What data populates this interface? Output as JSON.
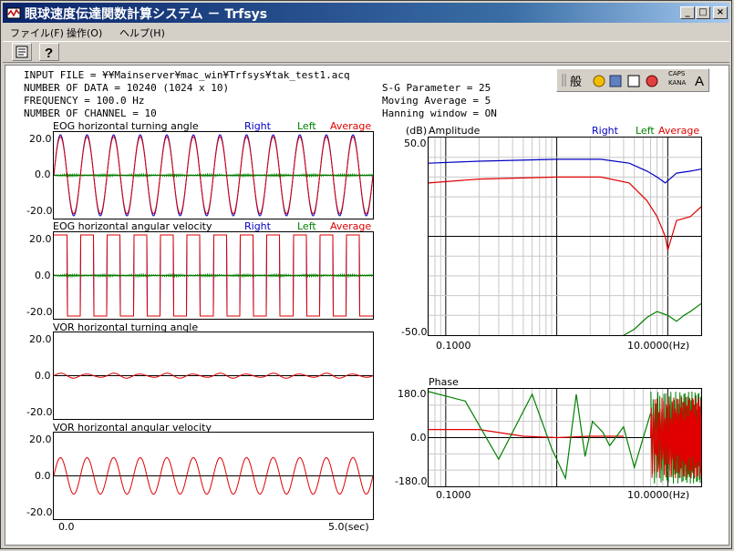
{
  "window": {
    "title": "眼球速度伝達関数計算システム － Trfsys",
    "min_glyph": "_",
    "max_glyph": "□",
    "close_glyph": "×"
  },
  "menu": {
    "file": "ファイル(F)",
    "operate": "操作(O)",
    "help": "ヘルプ(H)"
  },
  "info": {
    "input_file": "INPUT FILE = ¥¥Mainserver¥mac_win¥Trfsys¥tak_test1.acq",
    "num_data": "NUMBER OF DATA = 10240 (1024 x 10)",
    "frequency": "FREQUENCY = 100.0 Hz",
    "num_channel": "NUMBER OF CHANNEL = 10",
    "sg": "S-G Parameter = 25",
    "moving_avg": "Moving Average = 5",
    "hanning": "Hanning window = ON"
  },
  "ime_bar": {
    "mode": "般",
    "caps": "CAPS",
    "kana": "KANA"
  },
  "legend": {
    "right": "Right",
    "left": "Left",
    "average": "Average"
  },
  "colors": {
    "right": "#0000c0",
    "left": "#008000",
    "average": "#e00000",
    "grid": "#c8c8c8"
  },
  "charts": [
    {
      "title": "EOG horizontal turning angle",
      "legend": true,
      "ticks": [
        "20.0",
        "0.0",
        "-20.0"
      ]
    },
    {
      "title": "EOG horizontal angular velocity",
      "legend": true,
      "ticks": [
        "20.0",
        "0.0",
        "-20.0"
      ]
    },
    {
      "title": "VOR horizontal turning angle",
      "legend": false,
      "ticks": [
        "20.0",
        "0.0",
        "-20.0"
      ]
    },
    {
      "title": "VOR horizontal angular velocity",
      "legend": false,
      "ticks": [
        "20.0",
        "0.0",
        "-20.0"
      ]
    }
  ],
  "time_axis": {
    "start": "0.0",
    "end": "5.0(sec)"
  },
  "amplitude": {
    "unit": "(dB)",
    "title": "Amplitude",
    "ytop": "50.0",
    "ybottom": "-50.0",
    "xleft": "0.1000",
    "xright": "10.0000(Hz)"
  },
  "phase": {
    "title": "Phase",
    "ytop": "180.0",
    "ymid": "0.0",
    "ybottom": "-180.0",
    "xleft": "0.1000",
    "xright": "10.0000(Hz)"
  },
  "chart_data": [
    {
      "type": "line",
      "title": "EOG horizontal turning angle",
      "ylim": [
        -20,
        20
      ],
      "xlim": [
        0,
        5
      ],
      "series": [
        {
          "name": "Right",
          "cycles": 12,
          "amplitude": 20
        },
        {
          "name": "Left",
          "cycles": 12,
          "amplitude": 0.5
        },
        {
          "name": "Average",
          "cycles": 12,
          "amplitude": 19
        }
      ]
    },
    {
      "type": "line",
      "title": "EOG horizontal angular velocity",
      "ylim": [
        -20,
        20
      ],
      "xlim": [
        0,
        5
      ],
      "series": [
        {
          "name": "Right",
          "shape": "square",
          "cycles": 12,
          "amplitude": 20
        },
        {
          "name": "Left",
          "amplitude": 0.5
        },
        {
          "name": "Average",
          "shape": "square",
          "cycles": 12,
          "amplitude": 20
        }
      ]
    },
    {
      "type": "line",
      "title": "VOR horizontal turning angle",
      "ylim": [
        -20,
        20
      ],
      "xlim": [
        0,
        5
      ],
      "series": [
        {
          "name": "Average",
          "cycles": 12,
          "amplitude": 1
        }
      ]
    },
    {
      "type": "line",
      "title": "VOR horizontal angular velocity",
      "ylim": [
        -20,
        20
      ],
      "xlim": [
        0,
        5
      ],
      "series": [
        {
          "name": "Average",
          "cycles": 12,
          "amplitude": 9
        }
      ]
    },
    {
      "type": "line",
      "title": "Amplitude",
      "ylabel": "(dB)",
      "ylim": [
        -50,
        50
      ],
      "xscale": "log",
      "xlim": [
        0.07,
        20
      ],
      "series": [
        {
          "name": "Right",
          "x": [
            0.07,
            0.2,
            1.0,
            2.5,
            4.5,
            6.5,
            8.0,
            9.5,
            12,
            16,
            20
          ],
          "y": [
            37,
            38,
            39,
            39,
            37,
            33,
            30,
            27,
            32,
            33,
            34
          ]
        },
        {
          "name": "Average",
          "x": [
            0.07,
            0.2,
            1.0,
            2.5,
            4.5,
            6.5,
            8.0,
            9.5,
            10,
            12,
            16,
            20
          ],
          "y": [
            27,
            29,
            30,
            30,
            27,
            18,
            10,
            0,
            -7,
            8,
            10,
            15
          ]
        },
        {
          "name": "Left",
          "x": [
            3.5,
            5,
            6.5,
            8,
            10,
            12,
            14,
            16,
            20
          ],
          "y": [
            -52,
            -47,
            -41,
            -38,
            -40,
            -43,
            -40,
            -38,
            -34
          ]
        }
      ]
    },
    {
      "type": "line",
      "title": "Phase",
      "ylim": [
        -180,
        180
      ],
      "xscale": "log",
      "xlim": [
        0.07,
        20
      ],
      "series": [
        {
          "name": "Average",
          "x": [
            0.07,
            0.2,
            0.5,
            1.0,
            2.0,
            4.0
          ],
          "y": [
            30,
            30,
            5,
            0,
            5,
            5
          ]
        },
        {
          "name": "Left",
          "x": [
            0.07,
            0.15,
            0.3,
            0.6,
            0.9,
            1.2,
            1.5,
            1.8,
            2.1,
            2.6,
            3.0,
            4.0,
            5.0,
            7.0
          ],
          "y": [
            170,
            135,
            -80,
            160,
            -40,
            -150,
            160,
            -70,
            60,
            20,
            -30,
            40,
            -110,
            90
          ]
        }
      ]
    }
  ]
}
